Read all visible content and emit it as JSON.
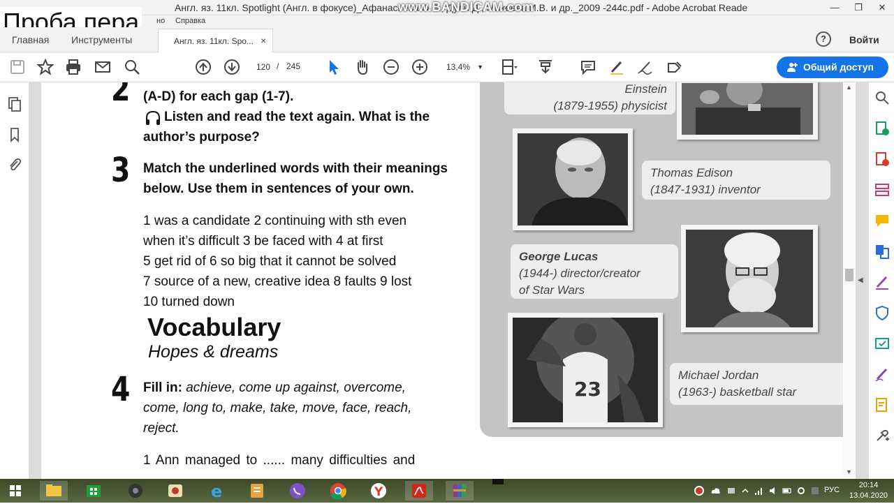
{
  "window": {
    "title": "Англ. яз. 11кл. Spotlight (Англ. в фокусе)_Афанасьева О.В., Дули Д., Михеева И.В. и др._2009 -244с.pdf - Adobe Acrobat Reader DC",
    "watermark": "www.BANDICAM.com",
    "overlay_label": "Проба пера",
    "controls": {
      "minimize": "—",
      "restore": "❐",
      "close": "✕"
    }
  },
  "menubar": {
    "items": [
      "но",
      "Справка"
    ]
  },
  "tabs": {
    "home": "Главная",
    "tools": "Инструменты",
    "document": "Англ. яз. 11кл. Spo...",
    "close": "×"
  },
  "header": {
    "help": "?",
    "sign_in": "Войти"
  },
  "toolbar": {
    "page_current": "120",
    "page_separator": "/",
    "page_total": "245",
    "zoom": "13,4%",
    "share_label": "Общий доступ",
    "accent_color": "#1473e6"
  },
  "document": {
    "ex2": {
      "number": "2",
      "line1": "(A-D) for each gap (1-7).",
      "line2": "Listen and read the text again. What is the",
      "line3": "author’s purpose?"
    },
    "ex3": {
      "number": "3",
      "line1": "Match the underlined words with their meanings",
      "line2": "below. Use them in sentences of your own.",
      "items": [
        "1 was a candidate  2 continuing with sth even",
        "when it’s difficult  3 be faced with  4 at first",
        "5 get rid of  6 so big that it cannot be solved",
        "7 source of a new, creative idea  8 faults  9 lost",
        "10 turned down"
      ]
    },
    "vocab": {
      "heading": "Vocabulary",
      "subheading": "Hopes & dreams"
    },
    "ex4": {
      "number": "4",
      "fill_label": "Fill in:",
      "words_line1": " achieve, come up against, overcome,",
      "words_line2": "come, long to, make, take, move, face, reach,",
      "words_line3": "reject.",
      "sentence": "1  Ann managed to ...... many difficulties and"
    },
    "captions": {
      "einstein_name": "Einstein",
      "einstein_desc": "(1879-1955) physicist",
      "edison_name": "Thomas Edison",
      "edison_desc": "(1847-1931) inventor",
      "lucas_name": "George Lucas",
      "lucas_desc1": "(1944-) director/creator",
      "lucas_desc2": "of Star Wars",
      "jordan_name": "Michael Jordan",
      "jordan_desc": "(1963-) basketball star",
      "jersey_number": "23"
    }
  },
  "taskbar": {
    "lang": "РУС",
    "time": "20:14",
    "date": "13.04.2020",
    "apps": [
      "start-icon",
      "file-explorer-icon",
      "store-icon",
      "media-icon",
      "paint-icon",
      "ie-icon",
      "docs-icon",
      "viber-icon",
      "chrome-icon",
      "yandex-icon",
      "acrobat-icon",
      "winrar-icon"
    ]
  }
}
